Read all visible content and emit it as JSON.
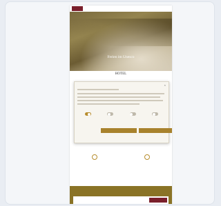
{
  "topbar": {
    "brand_text": "",
    "nav": [
      "",
      "",
      "",
      ""
    ]
  },
  "hero": {
    "logo": "",
    "title": "Ferien im Unesco"
  },
  "section_title": "HOTEL",
  "cookie_modal": {
    "heading": "",
    "close_glyph": "×",
    "toggles": [
      {
        "label": "",
        "on": true
      },
      {
        "label": "",
        "on": false
      },
      {
        "label": "",
        "on": false
      },
      {
        "label": "",
        "on": false
      }
    ],
    "link": "",
    "accept_selected_label": "",
    "accept_all_label": ""
  },
  "features": [
    {
      "label": "",
      "link": ""
    },
    {
      "label": "",
      "link": ""
    },
    {
      "label": "",
      "link": ""
    },
    {
      "label": "",
      "link": ""
    }
  ],
  "bottom_title": "",
  "booking": {
    "fields": [
      "",
      "",
      "",
      ""
    ],
    "button_label": ""
  },
  "colors": {
    "brand": "#7a1f2b",
    "accent": "#a8822c",
    "band": "#8a7326"
  }
}
